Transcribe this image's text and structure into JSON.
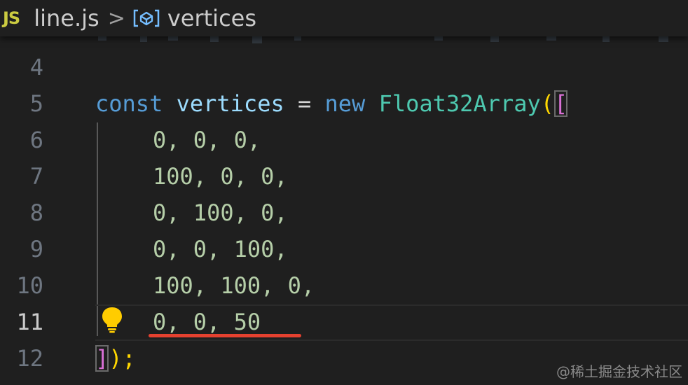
{
  "breadcrumb": {
    "file_icon": "JS",
    "file_name": "line.js",
    "separator": ">",
    "symbol_icon": "variable-icon",
    "symbol_name": "vertices"
  },
  "editor": {
    "lines": [
      {
        "number": "4",
        "text": ""
      },
      {
        "number": "5",
        "tokens": [
          "const",
          "vertices",
          "=",
          "new",
          "Float32Array",
          "(",
          "["
        ]
      },
      {
        "number": "6",
        "text": "0, 0, 0,"
      },
      {
        "number": "7",
        "text": "100, 0, 0,"
      },
      {
        "number": "8",
        "text": "0, 100, 0,"
      },
      {
        "number": "9",
        "text": "0, 0, 100,"
      },
      {
        "number": "10",
        "text": "100, 100, 0,"
      },
      {
        "number": "11",
        "text": "0, 0, 50"
      },
      {
        "number": "12",
        "tokens": [
          "]",
          ");"
        ]
      }
    ],
    "active_line": "11"
  },
  "watermark": "@稀土掘金技术社区",
  "colors": {
    "keyword": "#569cd6",
    "variable": "#9cdcfe",
    "class": "#4ec9b0",
    "number": "#b5cea8",
    "paren": "#ffd700",
    "bracket": "#da70d6",
    "underline": "#e5412f"
  }
}
